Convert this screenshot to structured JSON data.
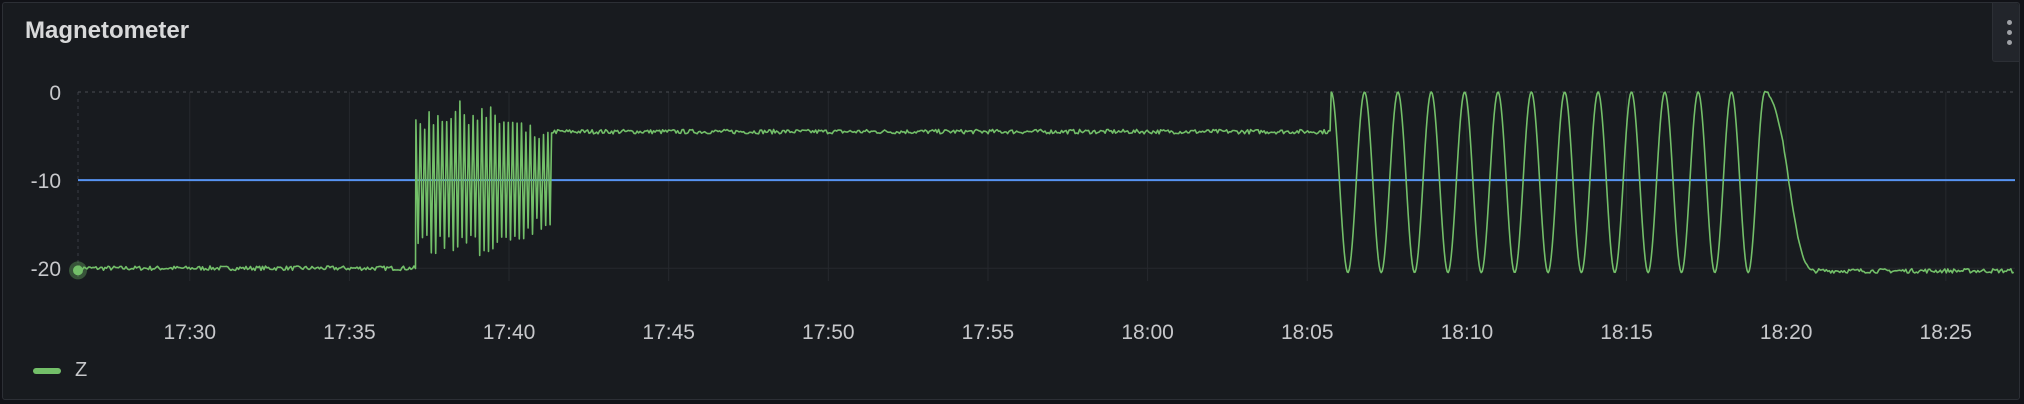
{
  "panel": {
    "title": "Magnetometer"
  },
  "chart_data": {
    "type": "line",
    "title": "Magnetometer",
    "xlabel": "",
    "ylabel": "",
    "x_ticks": [
      "17:30",
      "17:35",
      "17:40",
      "17:45",
      "17:50",
      "17:55",
      "18:00",
      "18:05",
      "18:10",
      "18:15",
      "18:20",
      "18:25"
    ],
    "y_ticks": [
      "0",
      "-10",
      "-20"
    ],
    "xlim": [
      "17:26:30",
      "18:27:10"
    ],
    "ylim": [
      -21,
      0
    ],
    "threshold": {
      "value": -10,
      "color": "#5794f2"
    },
    "legend_position": "bottom-left",
    "grid": true,
    "series": [
      {
        "name": "Z",
        "color": "#73bf69",
        "segments": [
          {
            "from": "17:26:30",
            "to": "17:37:05",
            "pattern": "flat",
            "level": -20
          },
          {
            "from": "17:37:05",
            "to": "17:41:20",
            "pattern": "dense-oscillation",
            "min": -19,
            "max": -1
          },
          {
            "from": "17:41:20",
            "to": "18:05:45",
            "pattern": "flat",
            "level": -4.5
          },
          {
            "from": "18:05:45",
            "to": "18:19:20",
            "pattern": "sine",
            "min": -20.5,
            "max": 0,
            "cycles": 13
          },
          {
            "from": "18:19:20",
            "to": "18:20:50",
            "pattern": "descent",
            "start": 0,
            "end": -20.3
          },
          {
            "from": "18:20:50",
            "to": "18:27:10",
            "pattern": "flat",
            "level": -20.3
          }
        ]
      }
    ]
  }
}
